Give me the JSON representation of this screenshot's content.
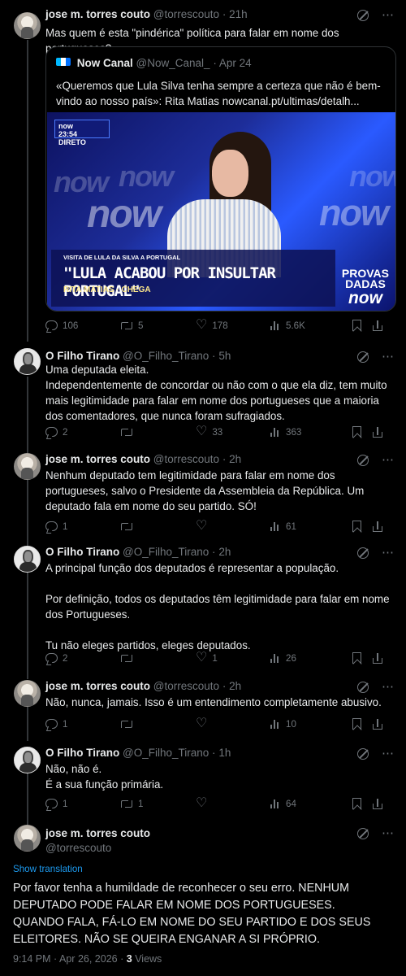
{
  "posts": [
    {
      "name": "jose m. torres couto",
      "handle": "@torrescouto",
      "separator": "·",
      "time": "21h",
      "text": "Mas quem é esta \"pindérica\" política para falar em nome dos portugueses?",
      "actions": {
        "replies": "106",
        "reposts": "5",
        "likes": "178",
        "views": "5.6K"
      },
      "quote": {
        "name": "Now Canal",
        "handle": "@Now_Canal_",
        "separator": "·",
        "time": "Apr 24",
        "text": "«Queremos que Lula Silva tenha sempre a certeza que não é bem-vindo ao nosso país»: Rita Matias nowcanal.pt/ultimas/detalh...",
        "video": {
          "live_logo": "now",
          "live_time": "23:54",
          "live_label": "DIRETO",
          "small_caption": "VISITA DE LULA DA SILVA A PORTUGAL",
          "headline": "\"LULA ACABOU POR INSULTAR PORTUGAL\"",
          "speaker": "RITA MATIAS · CHEGA",
          "program_line1": "PROVAS",
          "program_line2": "DADAS",
          "program_logo": "now",
          "background_logos": [
            "now",
            "now",
            "now",
            "now",
            "now"
          ]
        }
      }
    },
    {
      "name": "O Filho Tirano",
      "handle": "@O_Filho_Tirano",
      "separator": "·",
      "time": "5h",
      "text": "Uma deputada eleita.\nIndependentemente de concordar ou não com o que ela diz, tem muito mais legitimidade para falar em nome dos portugueses que a maioria dos comentadores, que nunca foram sufragiados.",
      "actions": {
        "replies": "2",
        "reposts": "",
        "likes": "33",
        "views": "363"
      }
    },
    {
      "name": "jose m. torres couto",
      "handle": "@torrescouto",
      "separator": "·",
      "time": "2h",
      "text": "Nenhum deputado tem legitimidade para falar em nome dos portugueses, salvo o Presidente da Assembleia da República. Um deputado fala em nome do seu partido. SÓ!",
      "actions": {
        "replies": "1",
        "reposts": "",
        "likes": "",
        "views": "61"
      }
    },
    {
      "name": "O Filho Tirano",
      "handle": "@O_Filho_Tirano",
      "separator": "·",
      "time": "2h",
      "text": "A principal função dos deputados é representar a população.\n\nPor definição, todos os deputados têm legitimidade para falar em nome dos Portugueses.\n\nTu não eleges partidos, eleges deputados.",
      "actions": {
        "replies": "2",
        "reposts": "",
        "likes": "1",
        "views": "26"
      }
    },
    {
      "name": "jose m. torres couto",
      "handle": "@torrescouto",
      "separator": "·",
      "time": "2h",
      "text": "Não, nunca, jamais. Isso é um entendimento completamente abusivo.",
      "actions": {
        "replies": "1",
        "reposts": "",
        "likes": "",
        "views": "10"
      }
    },
    {
      "name": "O Filho Tirano",
      "handle": "@O_Filho_Tirano",
      "separator": "·",
      "time": "1h",
      "text": "Não, não é.\nÉ a sua função primária.",
      "actions": {
        "replies": "1",
        "reposts": "1",
        "likes": "",
        "views": "64"
      }
    }
  ],
  "main_post": {
    "name": "jose m. torres couto",
    "handle": "@torrescouto",
    "show_translation": "Show translation",
    "text": "Por favor tenha a humildade de reconhecer o seu erro. NENHUM DEPUTADO PODE FALAR EM NOME DOS PORTUGUESES. QUANDO FALA, FÁ-LO EM NOME DO SEU PARTIDO E DOS SEUS ELEITORES. NÃO SE QUEIRA ENGANAR A SI PRÓPRIO.",
    "time": "9:14 PM",
    "separator": "·",
    "date": "Apr 26, 2026",
    "view_count": "3",
    "view_label": "Views"
  },
  "icons": {
    "reply": "reply-icon",
    "repost": "repost-icon",
    "like": "heart-icon",
    "views": "views-icon",
    "bookmark": "bookmark-icon",
    "share": "share-icon",
    "grok": "grok-icon",
    "more": "more-icon"
  },
  "colors": {
    "background": "#000000",
    "text": "#e7e9ea",
    "muted": "#71767b",
    "link": "#1d9bf0",
    "border": "#2f3336"
  }
}
